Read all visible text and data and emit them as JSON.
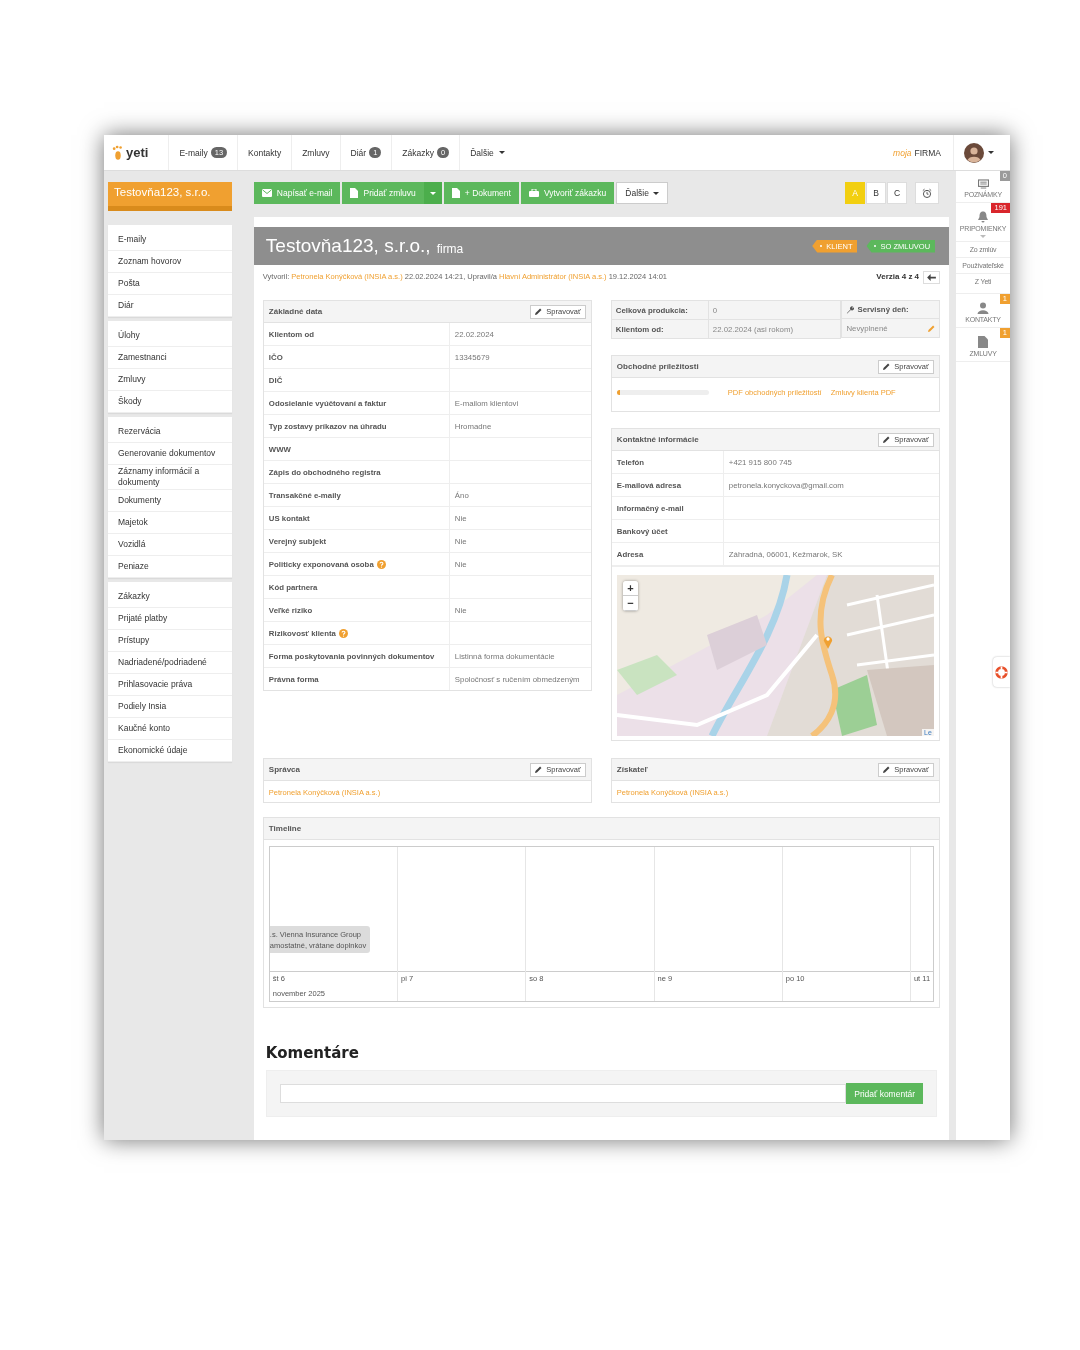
{
  "nav": {
    "logo": "yeti",
    "items": [
      {
        "label": "E-maily",
        "badge": "13",
        "caret": false
      },
      {
        "label": "Kontakty",
        "caret": false
      },
      {
        "label": "Zmluvy",
        "caret": false
      },
      {
        "label": "Diár",
        "badge": "1",
        "caret": false
      },
      {
        "label": "Zákazky",
        "badge": "0",
        "caret": false
      },
      {
        "label": "Ďalšie",
        "caret": true
      }
    ],
    "brand_prefix": "moja",
    "brand": "FIRMA"
  },
  "company": "Testovňa123, s.r.o.",
  "sidebar": {
    "groups": [
      [
        "E-maily",
        "Zoznam hovorov",
        "Pošta",
        "Diár"
      ],
      [
        "Úlohy",
        "Zamestnanci",
        "Zmluvy",
        "Škody"
      ],
      [
        "Rezervácia",
        "Generovanie dokumentov",
        "Záznamy informácií a dokumenty",
        "Dokumenty",
        "Majetok",
        "Vozidlá",
        "Peniaze"
      ],
      [
        "Zákazky",
        "Prijaté platby",
        "Prístupy",
        "Nadriadené/podriadené",
        "Prihlasovacie práva",
        "Podiely Insia",
        "Kaučné konto",
        "Ekonomické údaje"
      ]
    ]
  },
  "toolbar": {
    "buttons": [
      {
        "label": "Napísať e-mail",
        "kind": "email"
      },
      {
        "label": "Pridať zmluvu",
        "kind": "contract"
      },
      {
        "label": "+ Dokument",
        "kind": "document"
      },
      {
        "label": "Vytvoriť zákazku",
        "kind": "order"
      },
      {
        "label": "Ďalšie",
        "kind": "more"
      }
    ],
    "versions": [
      {
        "label": "A",
        "selected": true
      },
      {
        "label": "B",
        "selected": false
      },
      {
        "label": "C",
        "selected": false
      }
    ]
  },
  "header": {
    "title": "Testovňa123, s.r.o.,",
    "subtitle": "firma",
    "tags": [
      {
        "label": "KLIENT",
        "color": "#f0a030"
      },
      {
        "label": "SO ZMLUVOU",
        "color": "#5cb85c"
      }
    ]
  },
  "meta": {
    "parts": [
      {
        "kind": "text",
        "text": "Vytvoril:"
      },
      {
        "kind": "link",
        "text": "Petronela Konýčková (INSIA a.s.)"
      },
      {
        "kind": "text",
        "text": "22.02.2024 14:21, Upravil/a"
      },
      {
        "kind": "link",
        "text": "Hlavní Administrátor (INSIA a.s.)"
      },
      {
        "kind": "text",
        "text": "19.12.2024 14:01"
      }
    ],
    "version": "Verzia 4 z 4"
  },
  "basic_data": {
    "title": "Základné data",
    "edit": "Spravovať",
    "rows": [
      {
        "label": "Klientom od",
        "value": "22.02.2024",
        "help": false
      },
      {
        "label": "IČO",
        "value": "13345679",
        "help": false
      },
      {
        "label": "DIČ",
        "help": false
      },
      {
        "label": "Odosielanie vyúčtovaní a faktur",
        "value": "E-mailom klientovi",
        "help": false
      },
      {
        "label": "Typ zostavy príkazov na úhradu",
        "value": "Hromadne",
        "help": false
      },
      {
        "label": "WWW",
        "help": false
      },
      {
        "label": "Zápis do obchodného registra",
        "help": false
      },
      {
        "label": "Transakčné e-maily",
        "value": "Áno",
        "help": false
      },
      {
        "label": "US kontakt",
        "value": "Nie",
        "help": false
      },
      {
        "label": "Verejný subjekt",
        "value": "Nie",
        "help": false
      },
      {
        "label": "Politicky exponovaná osoba",
        "value": "Nie",
        "help": true
      },
      {
        "label": "Kód partnera",
        "help": false
      },
      {
        "label": "Veľké riziko",
        "value": "Nie",
        "help": false
      },
      {
        "label": "Rizikovosť klienta",
        "help": true
      },
      {
        "label": "Forma poskytovania povinných dokumentov",
        "value": "Listinná forma dokumentácie",
        "help": false
      },
      {
        "label": "Právna forma",
        "value": "Spoločnosť s ručením obmedzeným",
        "help": false
      }
    ]
  },
  "production": {
    "rows": [
      {
        "label": "Celková produkcia:",
        "value": "0"
      },
      {
        "label": "Klientom od:",
        "value": "22.02.2024 (asi rokom)"
      }
    ]
  },
  "service_day": {
    "title": "Servisný deň:",
    "value": "Nevyplnené"
  },
  "opportunities": {
    "title": "Obchodné príležitosti",
    "edit": "Spravovať",
    "level": 0.03,
    "links": [
      "PDF obchodných príležitostí",
      "Zmluvy klienta PDF"
    ]
  },
  "contact": {
    "title": "Kontaktné informácie",
    "edit": "Spravovať",
    "rows": [
      {
        "label": "Telefón",
        "value": "+421 915 800 745"
      },
      {
        "label": "E-mailová adresa",
        "value": "petronela.konyckova@gmail.com"
      },
      {
        "label": "Informačný e-mail"
      },
      {
        "label": "Bankový účet"
      },
      {
        "label": "Adresa",
        "value": "Záhradná, 06001, Kežmarok, SK"
      }
    ],
    "map": {
      "kind": "picture",
      "zoom": [
        "+",
        "−"
      ],
      "attribution": "Le"
    }
  },
  "manager": {
    "title": "Správca",
    "edit": "Spravovať",
    "person": "Petronela Konýčková (INSIA a.s.)"
  },
  "acquirer": {
    "title": "Získateľ",
    "edit": "Spravovať",
    "person": "Petronela Konýčková (INSIA a.s.)"
  },
  "timeline": {
    "title": "Timeline",
    "event": [
      ".s. Vienna Insurance Group",
      "amostatné, vrátane doplnkov"
    ],
    "days": [
      "št 6",
      "pi 7",
      "so 8",
      "ne 9",
      "po 10",
      "ut 11"
    ],
    "month": "november 2025"
  },
  "comments": {
    "title": "Komentáre",
    "button": "Pridať komentár"
  },
  "rail": {
    "items": [
      {
        "kind": "notes",
        "label": "POZNÁMKY",
        "badge": "0",
        "color": "#9a9a9a"
      },
      {
        "kind": "reminders",
        "label": "PRIPOMIENKY",
        "badge": "191",
        "color": "#d9262c",
        "subitems": [
          "Zo zmlúv",
          "Používateľské",
          "Z Yeti"
        ]
      },
      {
        "kind": "contacts",
        "label": "KONTAKTY",
        "badge": "1",
        "color": "#f0a030"
      },
      {
        "kind": "contracts",
        "label": "ZMLUVY",
        "badge": "1",
        "color": "#f0a030"
      }
    ]
  }
}
